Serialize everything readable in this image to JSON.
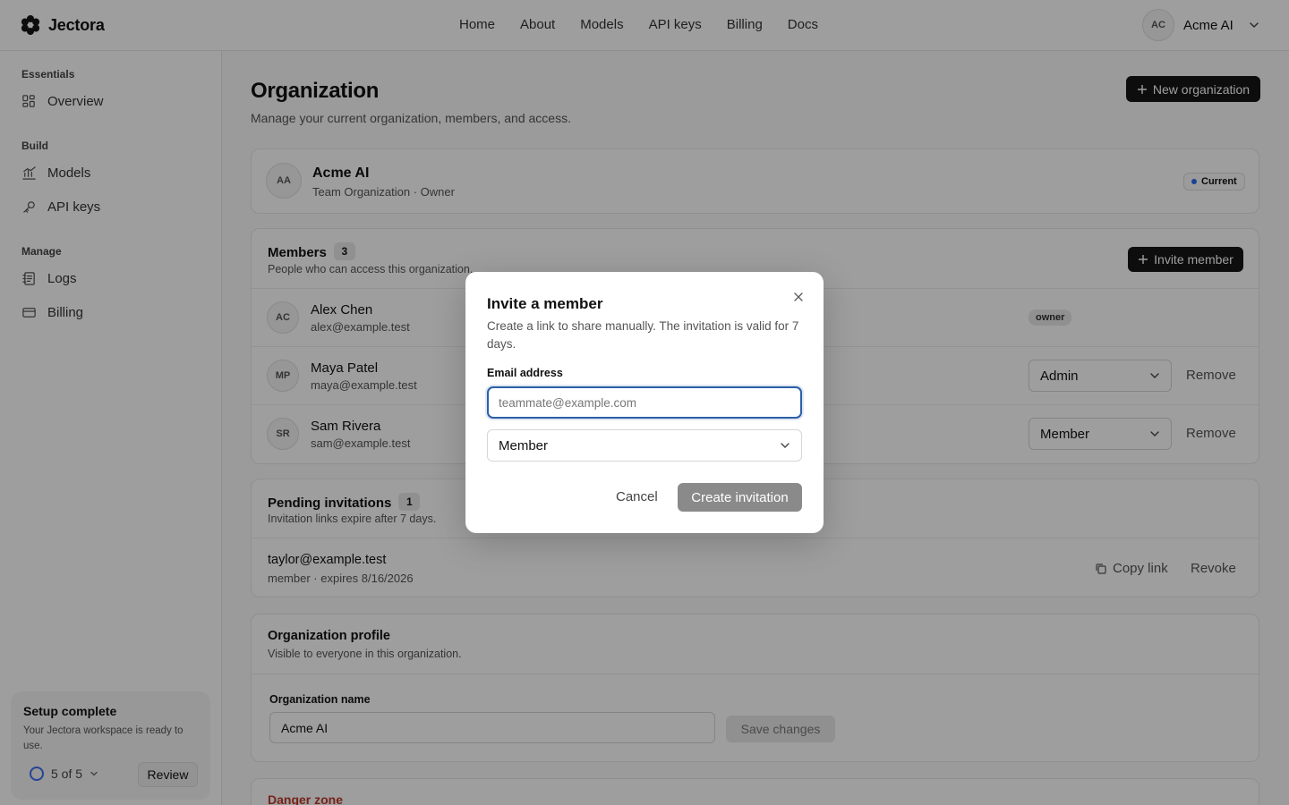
{
  "brand": {
    "name": "Jectora"
  },
  "nav": {
    "links": [
      "Home",
      "About",
      "Models",
      "API keys",
      "Billing",
      "Docs"
    ]
  },
  "account": {
    "initials": "AC",
    "name": "Acme AI"
  },
  "sidebar": {
    "sections": [
      {
        "title": "Essentials",
        "items": [
          {
            "label": "Overview",
            "icon": "grid-icon"
          }
        ]
      },
      {
        "title": "Build",
        "items": [
          {
            "label": "Models",
            "icon": "chart-icon"
          },
          {
            "label": "API keys",
            "icon": "key-icon"
          }
        ]
      },
      {
        "title": "Manage",
        "items": [
          {
            "label": "Logs",
            "icon": "logs-icon"
          },
          {
            "label": "Billing",
            "icon": "card-icon"
          }
        ]
      }
    ],
    "setup": {
      "title": "Setup complete",
      "desc": "Your Jectora workspace is ready to use.",
      "progress": "5 of 5",
      "review": "Review"
    }
  },
  "page": {
    "title": "Organization",
    "subtitle": "Manage your current organization, members, and access.",
    "new_org_label": "New organization"
  },
  "org": {
    "initials": "AA",
    "name": "Acme AI",
    "meta": "Team Organization · Owner",
    "badge": "Current"
  },
  "members": {
    "title": "Members",
    "count": "3",
    "subtitle": "People who can access this organization.",
    "invite_label": "Invite member",
    "rows": [
      {
        "initials": "AC",
        "name": "Alex Chen",
        "email": "alex@example.test",
        "role": "owner"
      },
      {
        "initials": "MP",
        "name": "Maya Patel",
        "email": "maya@example.test",
        "role": "Admin",
        "action": "Remove"
      },
      {
        "initials": "SR",
        "name": "Sam Rivera",
        "email": "sam@example.test",
        "role": "Member",
        "action": "Remove"
      }
    ]
  },
  "pending": {
    "title": "Pending invitations",
    "count": "1",
    "subtitle": "Invitation links expire after 7 days.",
    "rows": [
      {
        "email": "taylor@example.test",
        "meta": "member · expires 8/16/2026",
        "copy": "Copy link",
        "revoke": "Revoke"
      }
    ]
  },
  "profile": {
    "title": "Organization profile",
    "subtitle": "Visible to everyone in this organization.",
    "field_label": "Organization name",
    "field_value": "Acme AI",
    "save_label": "Save changes"
  },
  "danger": {
    "title": "Danger zone"
  },
  "modal": {
    "title": "Invite a member",
    "desc": "Create a link to share manually. The invitation is valid for 7 days.",
    "email_label": "Email address",
    "email_placeholder": "teammate@example.com",
    "role_value": "Member",
    "cancel": "Cancel",
    "create": "Create invitation"
  }
}
